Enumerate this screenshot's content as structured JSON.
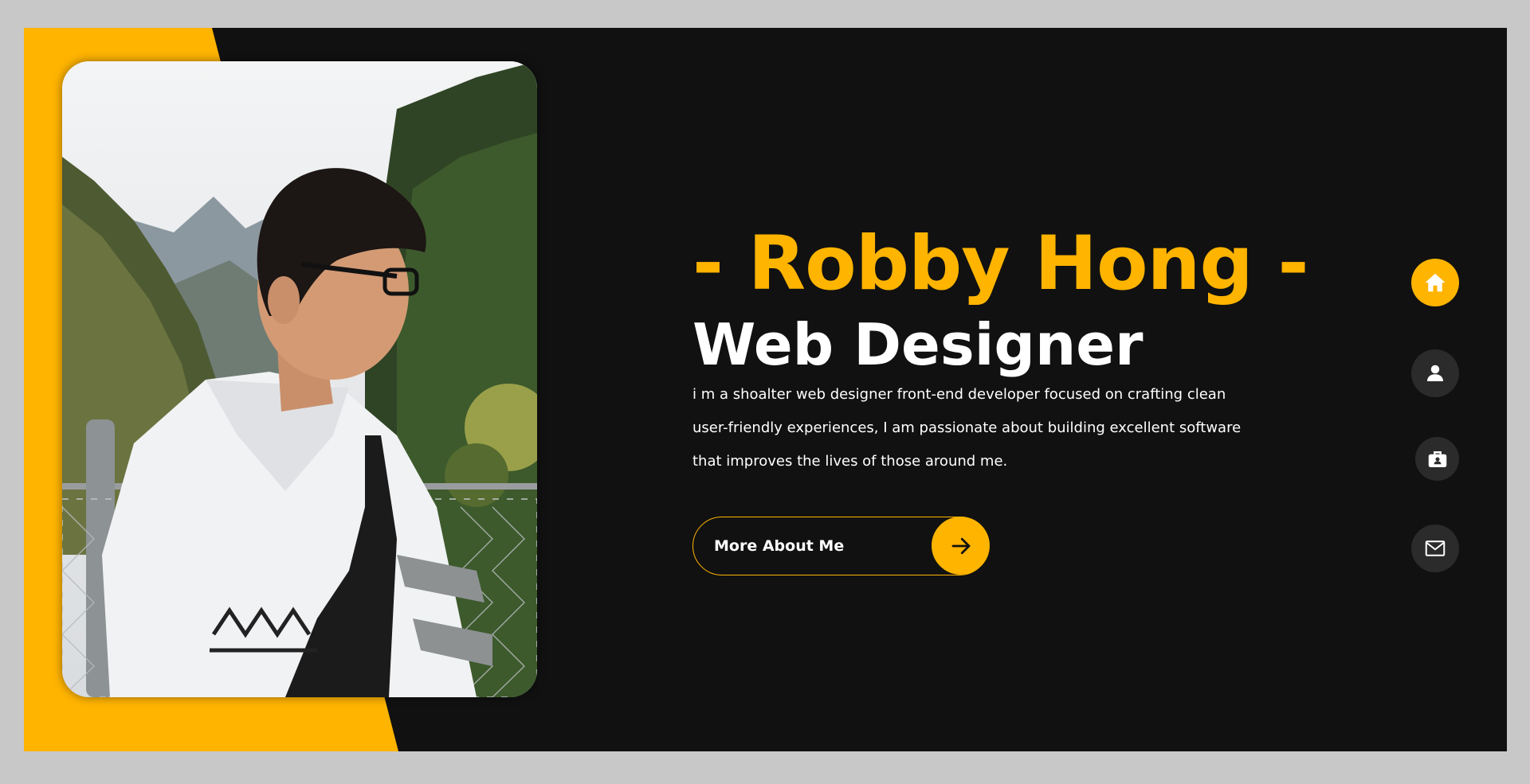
{
  "hero": {
    "name": "- Robby Hong -",
    "role": "Web Designer",
    "description": "i m a shoalter web designer front-end developer focused on crafting clean user-friendly experiences, I am passionate about building excellent software that improves the lives of those around me.",
    "cta_label": "More About Me"
  },
  "nav": {
    "items": [
      {
        "name": "home",
        "icon": "home-icon",
        "active": true
      },
      {
        "name": "about",
        "icon": "user-icon",
        "active": false
      },
      {
        "name": "portfolio",
        "icon": "briefcase-icon",
        "active": false
      },
      {
        "name": "contact",
        "icon": "envelope-icon",
        "active": false
      }
    ]
  },
  "colors": {
    "accent": "#ffb400",
    "background": "#111111",
    "nav_inactive": "#2b2b2b",
    "text": "#ffffff"
  },
  "photo": {
    "subject": "profile-photo"
  }
}
